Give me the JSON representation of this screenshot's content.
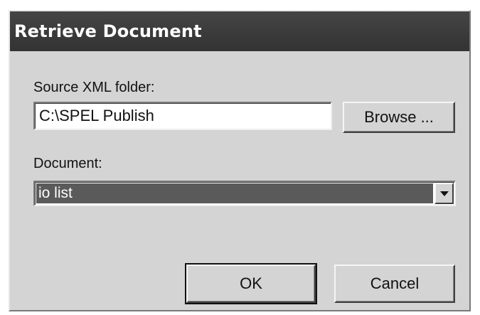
{
  "dialog": {
    "title": "Retrieve Document"
  },
  "source": {
    "label": "Source XML folder:",
    "value": "C:\\SPEL Publish",
    "browse_label": "Browse ..."
  },
  "document": {
    "label": "Document:",
    "selected": "io list"
  },
  "buttons": {
    "ok_label": "OK",
    "cancel_label": "Cancel"
  },
  "icons": {
    "dropdown": "chevron-down-icon"
  }
}
